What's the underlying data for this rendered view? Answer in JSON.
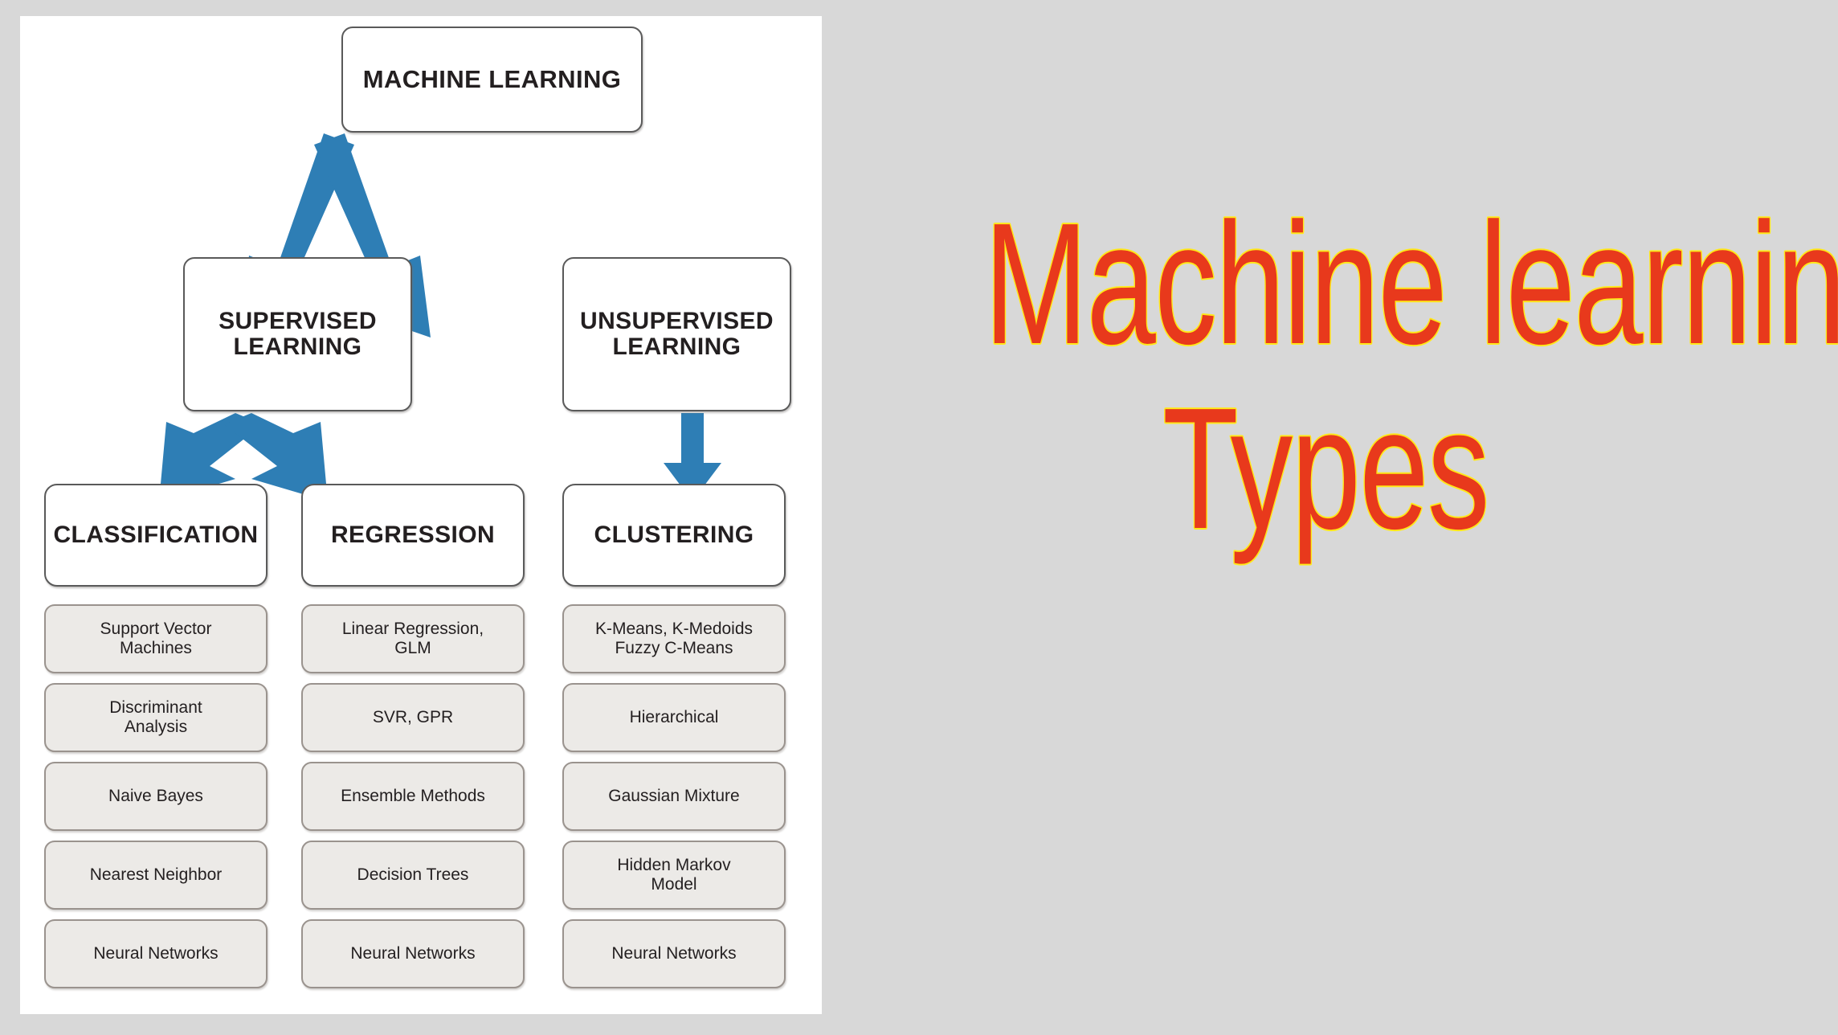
{
  "canvas": {
    "background_color": "#d8d8d8",
    "panel_color": "#ffffff"
  },
  "title": {
    "line1": "Machine learning",
    "line2": "Types",
    "fill_color": "#e8391c",
    "outline_color": "#ffe81a"
  },
  "diagram": {
    "arrow_color": "#2e7eb5",
    "root": {
      "label": "MACHINE LEARNING"
    },
    "level2": [
      {
        "label": "SUPERVISED\nLEARNING",
        "line1": "SUPERVISED",
        "line2": "LEARNING"
      },
      {
        "label": "UNSUPERVISED\nLEARNING",
        "line1": "UNSUPERVISED",
        "line2": "LEARNING"
      }
    ],
    "columns": [
      {
        "category": "CLASSIFICATION",
        "items": [
          {
            "line1": "Support Vector",
            "line2": "Machines"
          },
          {
            "line1": "Discriminant",
            "line2": "Analysis"
          },
          {
            "line1": "Naive Bayes",
            "line2": ""
          },
          {
            "line1": "Nearest Neighbor",
            "line2": ""
          },
          {
            "line1": "Neural Networks",
            "line2": ""
          }
        ]
      },
      {
        "category": "REGRESSION",
        "items": [
          {
            "line1": "Linear Regression,",
            "line2": "GLM"
          },
          {
            "line1": "SVR, GPR",
            "line2": ""
          },
          {
            "line1": "Ensemble Methods",
            "line2": ""
          },
          {
            "line1": "Decision Trees",
            "line2": ""
          },
          {
            "line1": "Neural Networks",
            "line2": ""
          }
        ]
      },
      {
        "category": "CLUSTERING",
        "items": [
          {
            "line1": "K-Means, K-Medoids",
            "line2": "Fuzzy C-Means"
          },
          {
            "line1": "Hierarchical",
            "line2": ""
          },
          {
            "line1": "Gaussian Mixture",
            "line2": ""
          },
          {
            "line1": "Hidden Markov",
            "line2": "Model"
          },
          {
            "line1": "Neural Networks",
            "line2": ""
          }
        ]
      }
    ]
  }
}
